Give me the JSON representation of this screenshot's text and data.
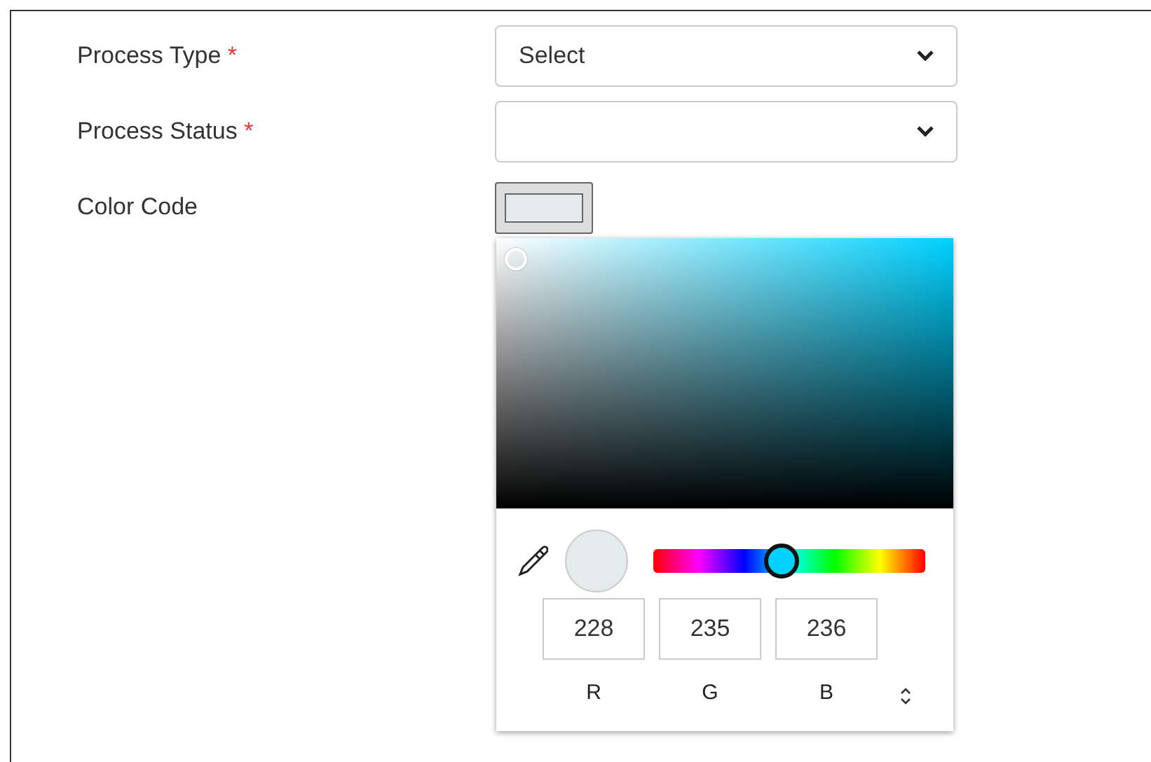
{
  "fields": [
    {
      "label": "Process Type",
      "required_mark": "*",
      "kind": "select",
      "value": "Select"
    },
    {
      "label": "Process Status",
      "required_mark": "*",
      "kind": "select"
    },
    {
      "label": "Color Code",
      "kind": "color"
    }
  ],
  "color_picker": {
    "hue": {
      "level": 0.47
    },
    "channels": [
      {
        "value": "228",
        "label": "R"
      },
      {
        "value": "235",
        "label": "G"
      },
      {
        "value": "236",
        "label": "B"
      }
    ]
  }
}
